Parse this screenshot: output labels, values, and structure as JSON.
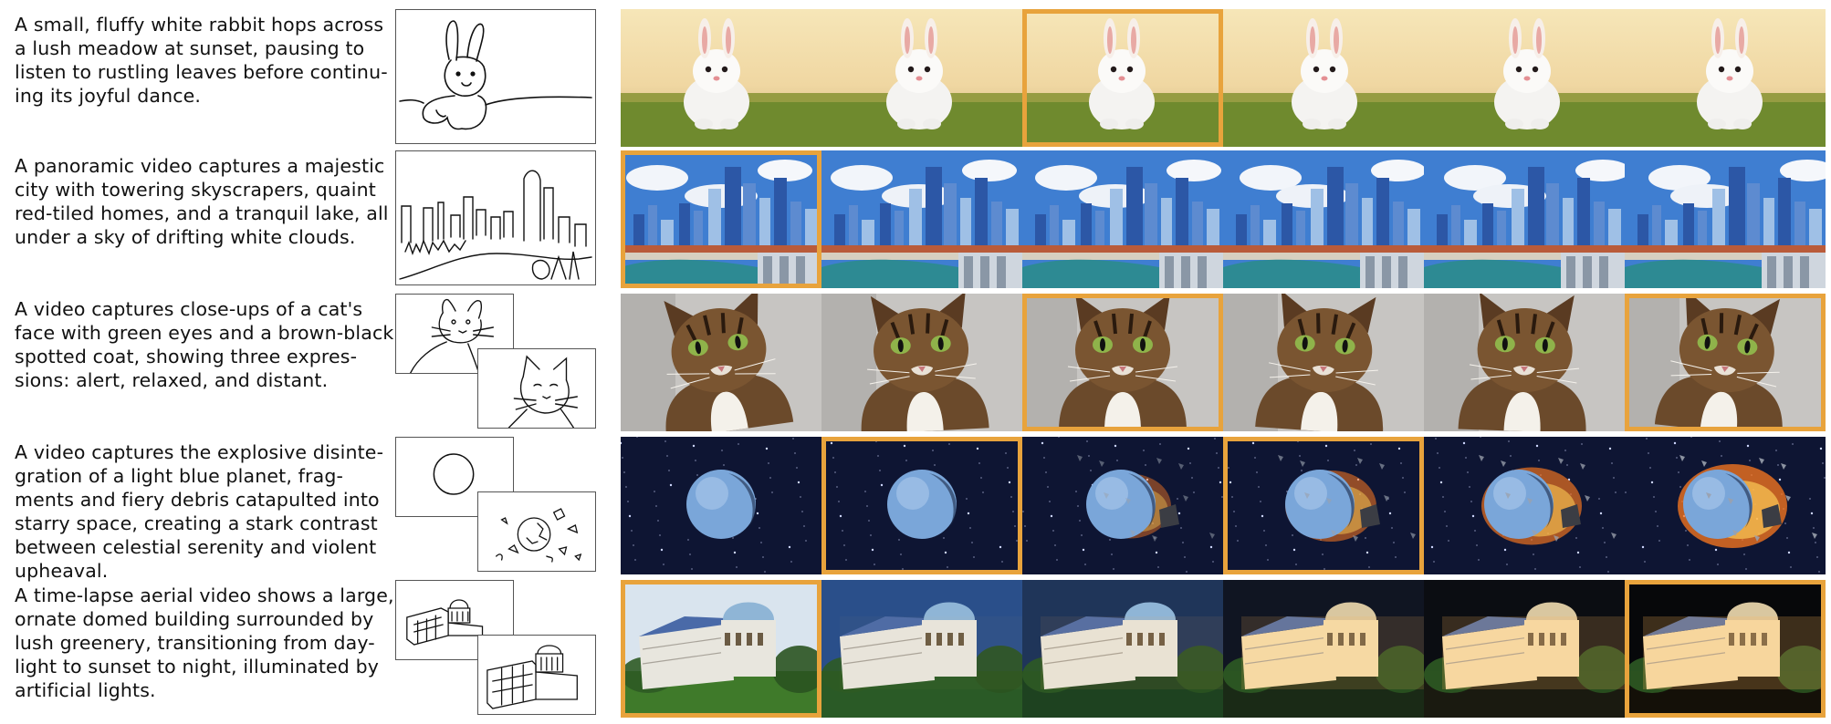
{
  "figure": {
    "highlight_color": "#E8A33C",
    "rows": [
      {
        "id": "rabbit",
        "caption_lines": [
          "A small, fluffy white rabbit hops across",
          "a lush meadow at sunset, pausing to",
          "listen to rustling leaves before continu-",
          "ing its joyful dance."
        ],
        "sketch_layout": "single",
        "frame_scene": "rabbit",
        "highlighted_frames": [
          2
        ]
      },
      {
        "id": "city",
        "caption_lines": [
          "A panoramic video captures a majestic",
          "city with towering skyscrapers, quaint",
          "red-tiled homes, and a tranquil lake, all",
          "under a sky of drifting white clouds."
        ],
        "sketch_layout": "single",
        "frame_scene": "city",
        "highlighted_frames": [
          0
        ]
      },
      {
        "id": "cat",
        "caption_lines": [
          "A video captures close-ups of a cat's",
          "face with green eyes and a brown-black",
          "spotted coat, showing three expres-",
          "sions: alert, relaxed, and distant."
        ],
        "sketch_layout": "double",
        "frame_scene": "cat",
        "highlighted_frames": [
          2,
          5
        ]
      },
      {
        "id": "planet",
        "caption_lines": [
          "A video captures the explosive disinte-",
          "gration of a light blue planet, frag-",
          "ments and fiery debris catapulted into",
          "starry space, creating a stark contrast",
          "between celestial serenity and violent",
          "upheaval."
        ],
        "sketch_layout": "double",
        "frame_scene": "planet",
        "highlighted_frames": [
          1,
          3
        ]
      },
      {
        "id": "building",
        "caption_lines": [
          "A time-lapse aerial video shows a large,",
          "ornate domed building surrounded by",
          "lush greenery, transitioning from day-",
          "light to sunset to night, illuminated by",
          "artificial lights."
        ],
        "sketch_layout": "double",
        "frame_scene": "building",
        "highlighted_frames": [
          0,
          5
        ]
      }
    ]
  }
}
